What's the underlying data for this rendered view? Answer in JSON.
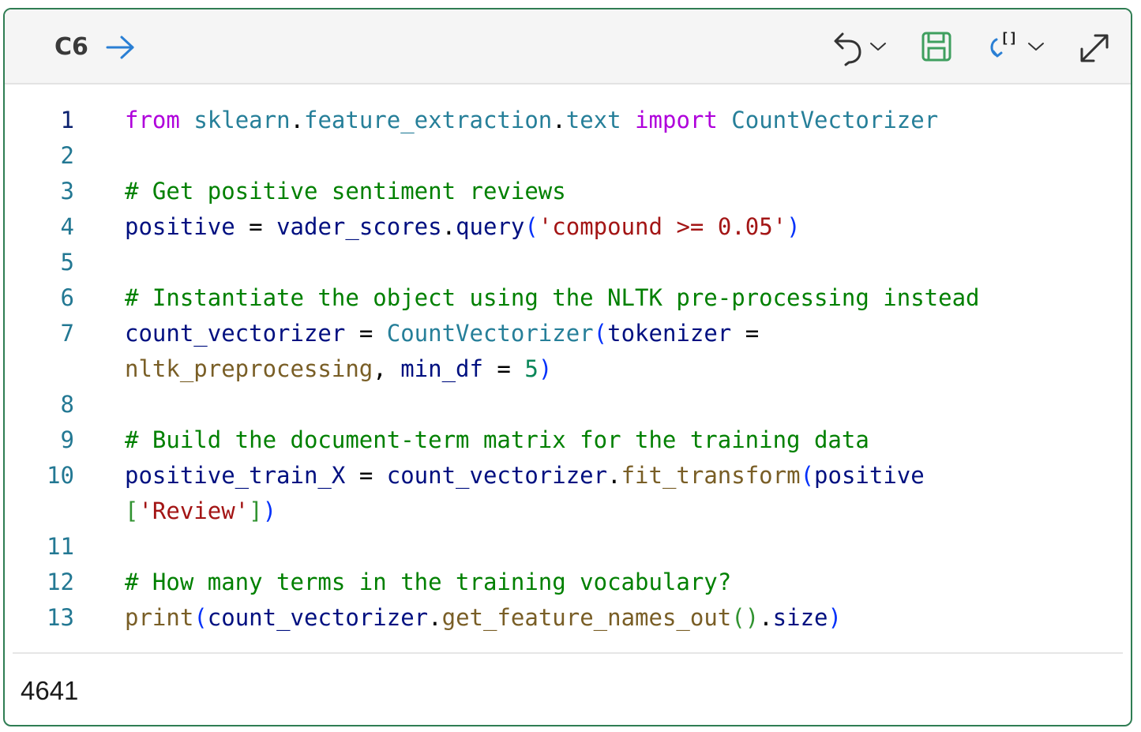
{
  "cell": {
    "id": "C6",
    "output": "4641"
  },
  "toolbar": {
    "icons": [
      "run-arrow-icon",
      "undo-icon",
      "chevron-down-icon",
      "save-icon",
      "variable-insert-icon",
      "chevron-down-icon",
      "expand-icon"
    ],
    "accent_color": "#2f7d53",
    "run_color": "#2a7fd4",
    "save_color": "#3f9f5f"
  },
  "code": {
    "lines": [
      {
        "num": "1",
        "tokens": [
          [
            "kw",
            "from"
          ],
          [
            "op",
            " "
          ],
          [
            "mod",
            "sklearn"
          ],
          [
            "op",
            "."
          ],
          [
            "mod",
            "feature_extraction"
          ],
          [
            "op",
            "."
          ],
          [
            "mod",
            "text"
          ],
          [
            "op",
            " "
          ],
          [
            "kw",
            "import"
          ],
          [
            "op",
            " "
          ],
          [
            "cls",
            "CountVectorizer"
          ]
        ]
      },
      {
        "num": "2",
        "tokens": []
      },
      {
        "num": "3",
        "tokens": [
          [
            "com",
            "# Get positive sentiment reviews"
          ]
        ]
      },
      {
        "num": "4",
        "tokens": [
          [
            "var",
            "positive"
          ],
          [
            "op",
            " = "
          ],
          [
            "var",
            "vader_scores"
          ],
          [
            "op",
            "."
          ],
          [
            "var",
            "query"
          ],
          [
            "b1",
            "("
          ],
          [
            "str",
            "'compound >= 0.05'"
          ],
          [
            "b1",
            ")"
          ]
        ]
      },
      {
        "num": "5",
        "tokens": []
      },
      {
        "num": "6",
        "tokens": [
          [
            "com",
            "# Instantiate the object using the NLTK pre-processing instead"
          ]
        ]
      },
      {
        "num": "7",
        "tokens": [
          [
            "var",
            "count_vectorizer"
          ],
          [
            "op",
            " = "
          ],
          [
            "cls",
            "CountVectorizer"
          ],
          [
            "b1",
            "("
          ],
          [
            "var",
            "tokenizer"
          ],
          [
            "op",
            " ="
          ]
        ]
      },
      {
        "num": "",
        "tokens": [
          [
            "fn",
            "nltk_preprocessing"
          ],
          [
            "op",
            ", "
          ],
          [
            "var",
            "min_df"
          ],
          [
            "op",
            " = "
          ],
          [
            "num",
            "5"
          ],
          [
            "b1",
            ")"
          ]
        ]
      },
      {
        "num": "8",
        "tokens": []
      },
      {
        "num": "9",
        "tokens": [
          [
            "com",
            "# Build the document-term matrix for the training data"
          ]
        ]
      },
      {
        "num": "10",
        "tokens": [
          [
            "var",
            "positive_train_X"
          ],
          [
            "op",
            " = "
          ],
          [
            "var",
            "count_vectorizer"
          ],
          [
            "op",
            "."
          ],
          [
            "fn",
            "fit_transform"
          ],
          [
            "b1",
            "("
          ],
          [
            "var",
            "positive"
          ]
        ]
      },
      {
        "num": "",
        "tokens": [
          [
            "b2",
            "["
          ],
          [
            "str",
            "'Review'"
          ],
          [
            "b2",
            "]"
          ],
          [
            "b1",
            ")"
          ]
        ]
      },
      {
        "num": "11",
        "tokens": []
      },
      {
        "num": "12",
        "tokens": [
          [
            "com",
            "# How many terms in the training vocabulary?"
          ]
        ]
      },
      {
        "num": "13",
        "tokens": [
          [
            "fn",
            "print"
          ],
          [
            "b1",
            "("
          ],
          [
            "var",
            "count_vectorizer"
          ],
          [
            "op",
            "."
          ],
          [
            "fn",
            "get_feature_names_out"
          ],
          [
            "b2",
            "()"
          ],
          [
            "op",
            "."
          ],
          [
            "var",
            "size"
          ],
          [
            "b1",
            ")"
          ]
        ]
      }
    ]
  }
}
